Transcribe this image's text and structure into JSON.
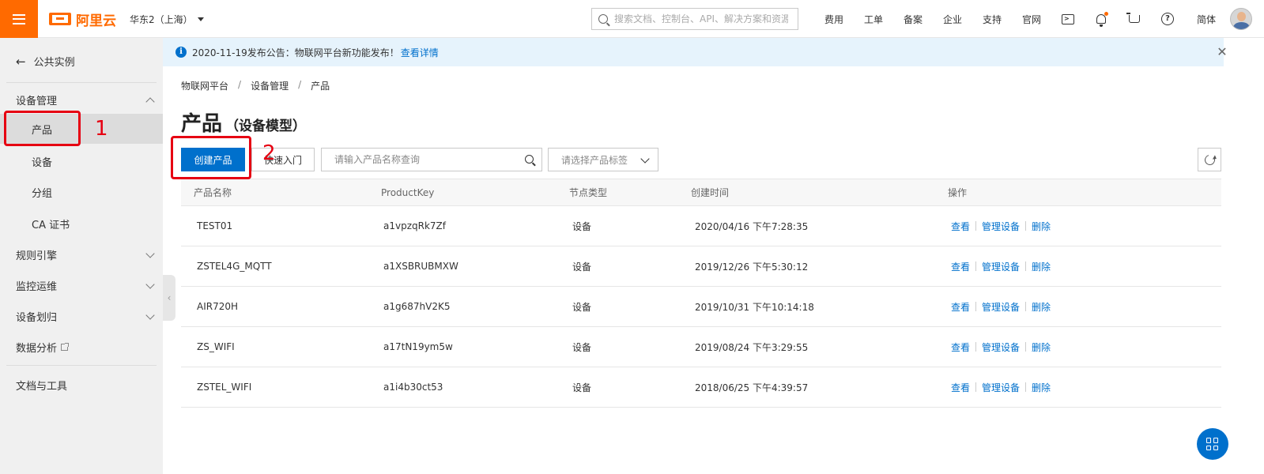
{
  "topbar": {
    "logo_text": "阿里云",
    "region": "华东2（上海）",
    "search_placeholder": "搜索文档、控制台、API、解决方案和资源",
    "links": [
      "费用",
      "工单",
      "备案",
      "企业",
      "支持",
      "官网"
    ],
    "language": "简体",
    "icons": [
      "terminal-icon",
      "bell-icon",
      "cart-icon",
      "help-icon"
    ]
  },
  "sidebar": {
    "back_label": "公共实例",
    "groups": {
      "device_mgmt": "设备管理",
      "rules": "规则引擎",
      "monitor": "监控运维",
      "assign": "设备划归",
      "analysis": "数据分析",
      "docs": "文档与工具"
    },
    "items": {
      "product": "产品",
      "device": "设备",
      "group": "分组",
      "ca": "CA 证书"
    }
  },
  "notice": {
    "text": "2020-11-19发布公告：物联网平台新功能发布！",
    "link": "查看详情"
  },
  "breadcrumb": [
    "物联网平台",
    "设备管理",
    "产品"
  ],
  "page": {
    "title": "产品",
    "subtitle": "（设备模型）"
  },
  "toolbar": {
    "create_label": "创建产品",
    "quickstart_label": "快速入门",
    "search_placeholder": "请输入产品名称查询",
    "tag_placeholder": "请选择产品标签"
  },
  "table": {
    "headers": [
      "产品名称",
      "ProductKey",
      "节点类型",
      "创建时间",
      "操作"
    ],
    "actions": [
      "查看",
      "管理设备",
      "删除"
    ],
    "rows": [
      {
        "name": "TEST01",
        "key": "a1vpzqRk7Zf",
        "type": "设备",
        "created": "2020/04/16 下午7:28:35"
      },
      {
        "name": "ZSTEL4G_MQTT",
        "key": "a1XSBRUBMXW",
        "type": "设备",
        "created": "2019/12/26 下午5:30:12"
      },
      {
        "name": "AIR720H",
        "key": "a1g687hV2K5",
        "type": "设备",
        "created": "2019/10/31 下午10:14:18"
      },
      {
        "name": "ZS_WIFI",
        "key": "a17tN19ym5w",
        "type": "设备",
        "created": "2019/08/24 下午3:29:55"
      },
      {
        "name": "ZSTEL_WIFI",
        "key": "a1i4b30ct53",
        "type": "设备",
        "created": "2018/06/25 下午4:39:57"
      }
    ]
  },
  "annotations": {
    "one": "1",
    "two": "2"
  },
  "colors": {
    "brand": "#ff6a00",
    "primary": "#0070cc",
    "annotation": "#e60012"
  }
}
